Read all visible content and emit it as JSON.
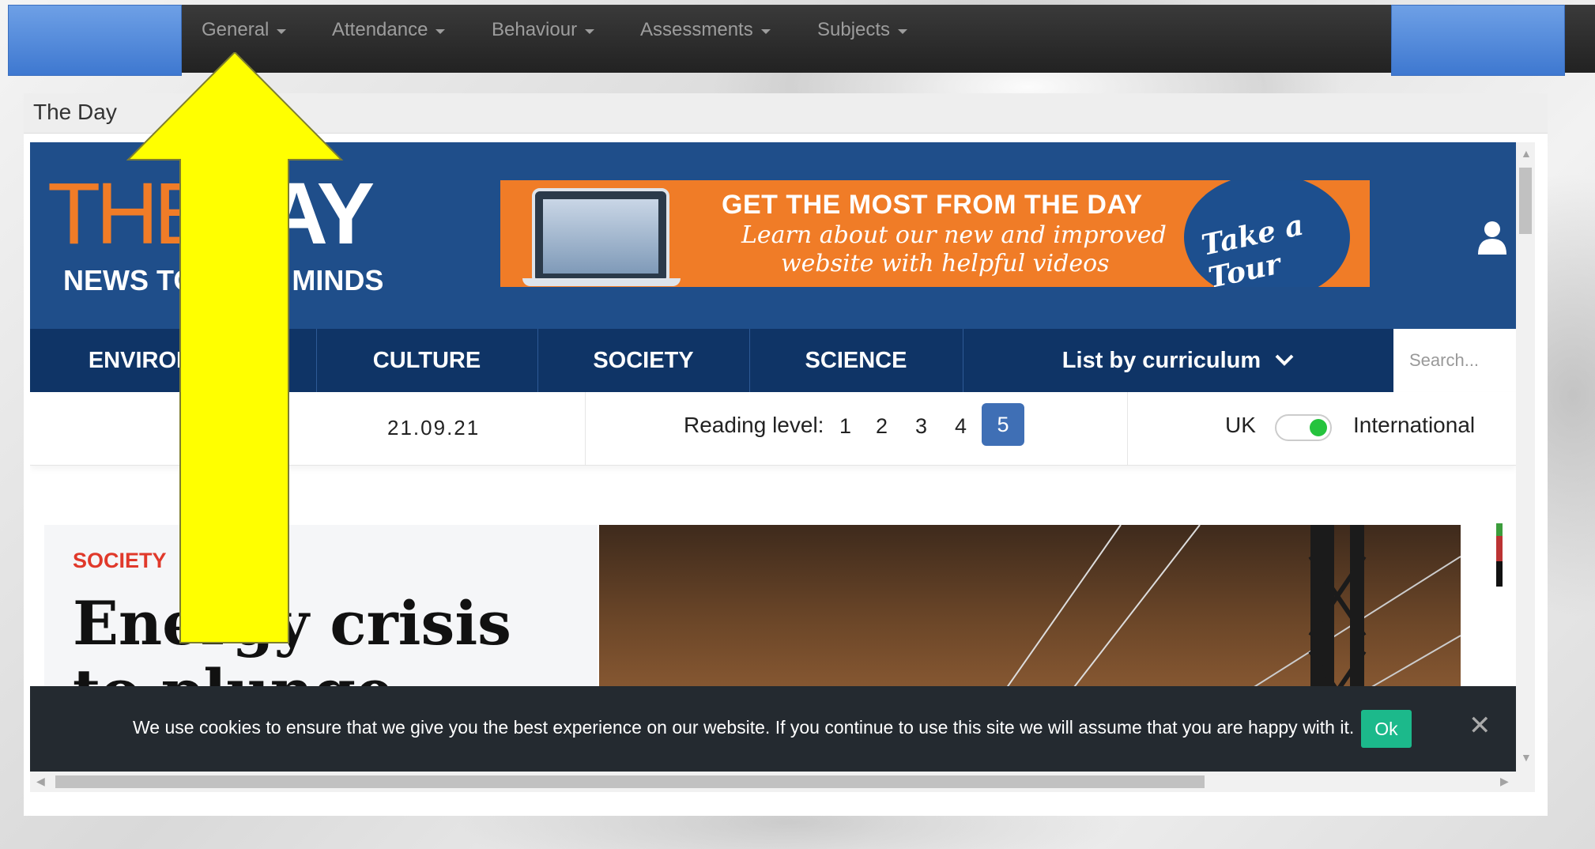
{
  "top_nav": {
    "items": [
      {
        "label": "General"
      },
      {
        "label": "Attendance"
      },
      {
        "label": "Behaviour"
      },
      {
        "label": "Assessments"
      },
      {
        "label": "Subjects"
      }
    ]
  },
  "panel": {
    "title": "The Day"
  },
  "site": {
    "logo": {
      "the": "THE",
      "day": "DAY",
      "tagline": "NEWS TO OPEN MINDS"
    },
    "banner": {
      "heading": "GET THE MOST FROM THE DAY",
      "line1": "Learn about our new and improved",
      "line2": "website with helpful videos",
      "cta": "Take a Tour"
    },
    "categories": [
      {
        "label": "ENVIRONMENT"
      },
      {
        "label": "CULTURE"
      },
      {
        "label": "SOCIETY"
      },
      {
        "label": "SCIENCE"
      },
      {
        "label": "List by curriculum"
      }
    ],
    "search_placeholder": "Search...",
    "date": "21.09.21",
    "reading_level": {
      "label": "Reading level:",
      "levels": [
        "1",
        "2",
        "3",
        "4",
        "5"
      ],
      "selected": "5"
    },
    "region": {
      "left": "UK",
      "right": "International",
      "selected": "International"
    },
    "article": {
      "category": "SOCIETY",
      "title": "Energy crisis to plunge Europe"
    }
  },
  "cookie": {
    "text": "We use cookies to ensure that we give you the best experience on our website. If you continue to use this site we will assume that you are happy with it.",
    "ok": "Ok"
  },
  "colors": {
    "navbar": "#222222",
    "brand_blue": "#1f4e8a",
    "brand_orange": "#f07c27",
    "annotation_arrow": "#ffff00",
    "cookie_ok": "#1cb98b"
  }
}
